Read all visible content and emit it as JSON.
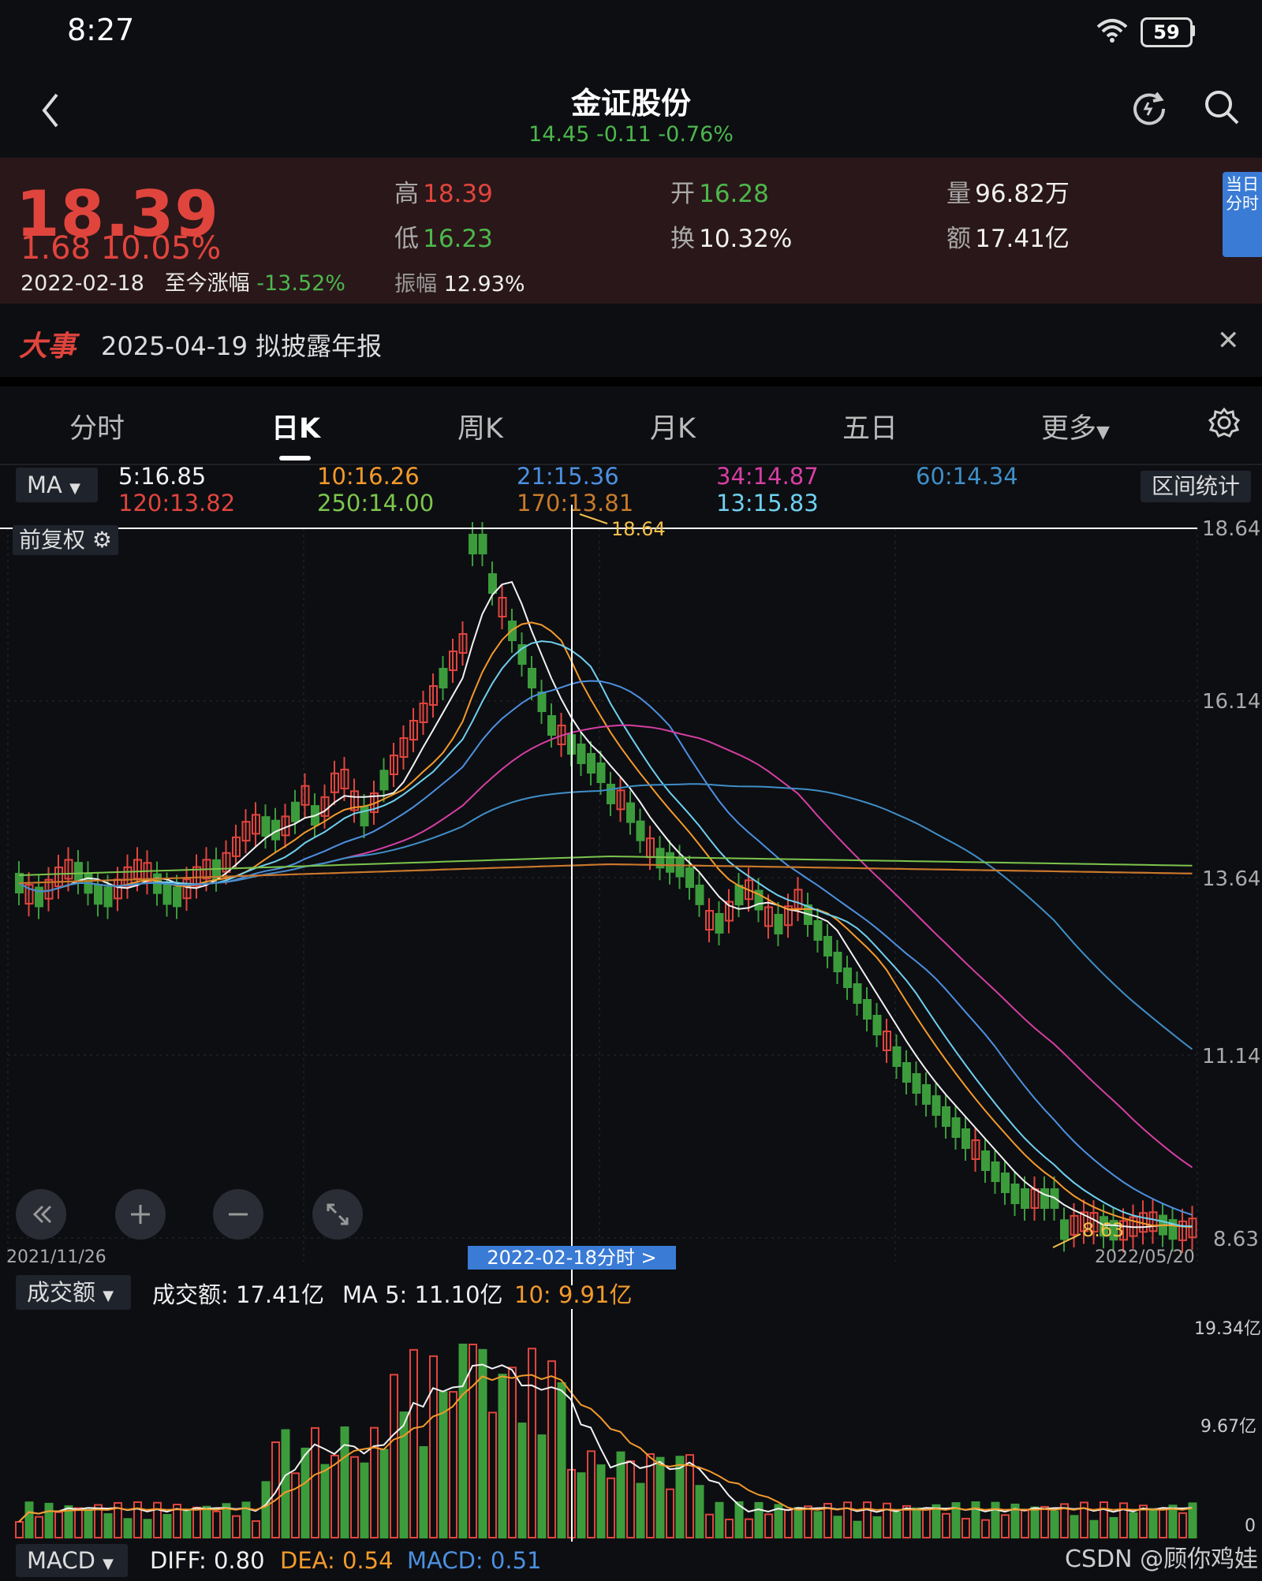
{
  "status_bar": {
    "time": "8:27",
    "battery": "59"
  },
  "header": {
    "title": "金证股份",
    "subtitle": "14.45  -0.11  -0.76%"
  },
  "quote": {
    "price": "18.39",
    "change": "1.68  10.05%",
    "date": "2022-02-18",
    "since_label": "至今涨幅",
    "since_value": "-13.52%",
    "high_label": "高",
    "high": "18.39",
    "low_label": "低",
    "low": "16.23",
    "amplitude_label": "振幅",
    "amplitude": "12.93%",
    "open_label": "开",
    "open": "16.28",
    "turnover_label": "换",
    "turnover": "10.32%",
    "volume_label": "量",
    "volume": "96.82万",
    "amount_label": "额",
    "amount": "17.41亿",
    "intraday_badge": "当日分时"
  },
  "event": {
    "icon_label": "大事",
    "text": "2025-04-19 拟披露年报"
  },
  "tabs": [
    {
      "label": "分时"
    },
    {
      "label": "日K"
    },
    {
      "label": "周K"
    },
    {
      "label": "月K"
    },
    {
      "label": "五日"
    },
    {
      "label": "更多"
    }
  ],
  "ma_legend": {
    "selector": "MA",
    "values": [
      "5:16.85",
      "10:16.26",
      "21:15.36",
      "34:14.87",
      "60:14.34",
      "120:13.82",
      "250:14.00",
      "170:13.81",
      "13:15.83"
    ],
    "range_stats": "区间统计",
    "adjust": "前复权"
  },
  "colors": {
    "ma5": "#f2f2f2",
    "ma10": "#f39a2c",
    "ma21": "#4c90e0",
    "ma34": "#d63fa3",
    "ma60": "#3f8fc8",
    "ma120": "#e0453d",
    "ma250": "#7cc64c",
    "ma170": "#c87b2a",
    "ma13": "#6fd0ef",
    "up": "#e0453d",
    "down": "#3c9c3c",
    "accent": "#3a7bd5"
  },
  "chart": {
    "y_ticks": [
      "18.64",
      "16.14",
      "13.64",
      "11.14",
      "8.63"
    ],
    "high_marker": "18.64",
    "low_marker": "8.63",
    "start_date": "2021/11/26",
    "end_date": "2022/05/20",
    "crosshair_date": "2022-02-18分时 >"
  },
  "volume": {
    "selector": "成交额",
    "amount": "成交额: 17.41亿",
    "ma5": "MA 5: 11.10亿",
    "ma10": "10: 9.91亿",
    "y_ticks": [
      "19.34亿",
      "9.67亿",
      "0"
    ]
  },
  "macd": {
    "selector": "MACD",
    "diff": "DIFF: 0.80",
    "dea": "DEA: 0.54",
    "macd": "MACD: 0.51"
  },
  "watermark": "CSDN @顾你鸡娃"
}
